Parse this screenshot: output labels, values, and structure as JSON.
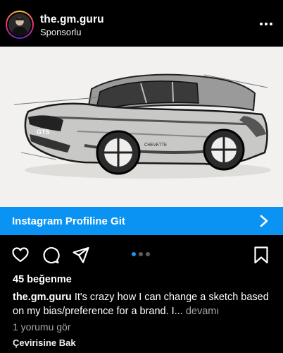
{
  "post": {
    "username": "the.gm.guru",
    "sponsored_label": "Sponsorlu"
  },
  "cta": {
    "label": "Instagram Profiline Git"
  },
  "carousel": {
    "count": 3,
    "active_index": 0,
    "active_color": "#1e90ff"
  },
  "engagement": {
    "likes_text": "45 beğenme"
  },
  "caption": {
    "username": "the.gm.guru",
    "text": "It's crazy how I can change a sketch based on my bias/preference for a brand. I...",
    "more_label": "devamı"
  },
  "comments": {
    "view_label": "1 yorumu gör"
  },
  "translation": {
    "label": "Çevirisine Bak"
  },
  "image": {
    "plate_text": "GTS",
    "side_text": "CHEVETTE"
  },
  "icons": [
    "heart-icon",
    "comment-icon",
    "share-icon",
    "bookmark-icon",
    "chevron-right-icon",
    "more-icon"
  ],
  "colors": {
    "cta": "#0a93f3",
    "background": "#000000",
    "muted": "#a8a8a8"
  }
}
